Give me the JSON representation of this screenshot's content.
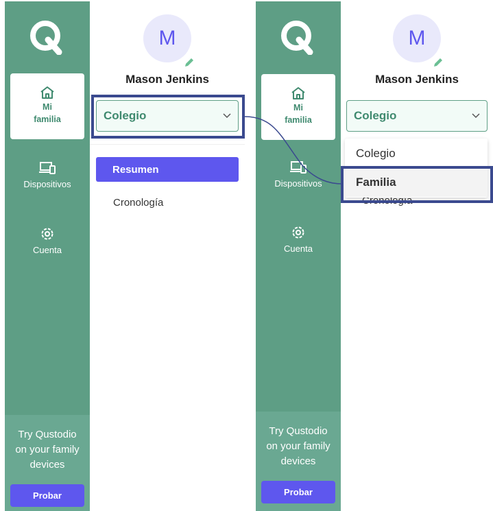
{
  "brand": {
    "accent": "#5e9e85",
    "primary": "#5e57ee",
    "annotation": "#3b4a8f"
  },
  "nav": {
    "home_label_1": "Mi",
    "home_label_2": "familia",
    "devices_label": "Dispositivos",
    "account_label": "Cuenta"
  },
  "promo": {
    "line1": "Try Qustodio",
    "line2": "on your family",
    "line3": "devices",
    "button": "Probar"
  },
  "profile": {
    "initial": "M",
    "name": "Mason Jenkins"
  },
  "selector": {
    "value": "Colegio"
  },
  "menu": {
    "active": "Resumen",
    "other": "Cronología"
  },
  "dropdown": {
    "options": [
      "Colegio",
      "Familia"
    ]
  }
}
